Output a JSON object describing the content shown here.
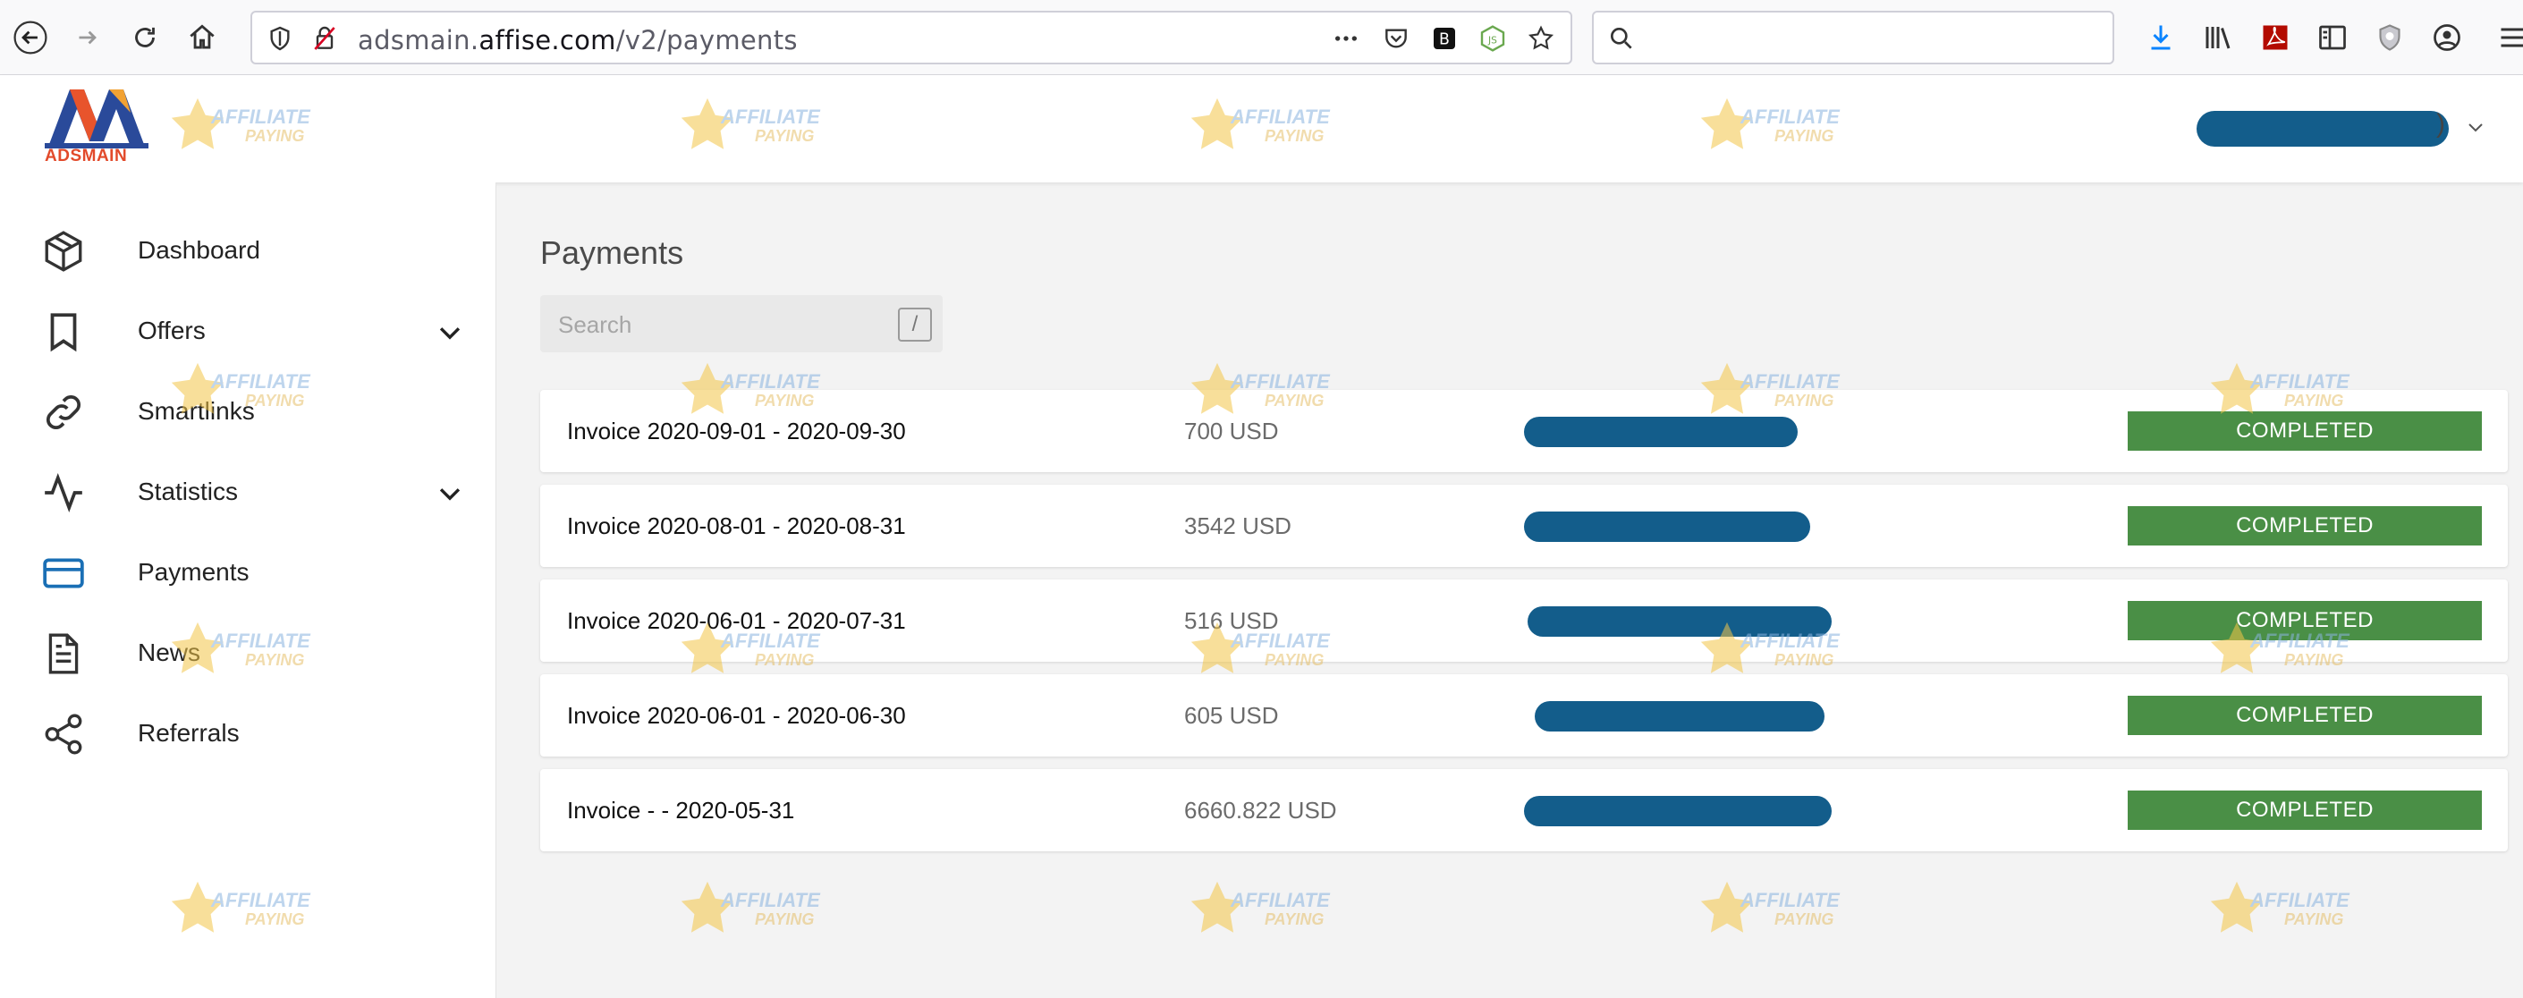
{
  "browser": {
    "url_prefix": "adsmain.",
    "url_domain": "affise.com",
    "url_path": "/v2/payments"
  },
  "logo": {
    "text": "ADSMAIN"
  },
  "header": {
    "user_suffix": ")"
  },
  "sidebar": {
    "items": [
      {
        "label": "Dashboard",
        "icon": "dashboard-cube-icon"
      },
      {
        "label": "Offers",
        "icon": "bookmark-icon",
        "expandable": true
      },
      {
        "label": "Smartlinks",
        "icon": "link-icon"
      },
      {
        "label": "Statistics",
        "icon": "activity-icon",
        "expandable": true
      },
      {
        "label": "Payments",
        "icon": "credit-card-icon",
        "active": true
      },
      {
        "label": "News",
        "icon": "document-icon"
      },
      {
        "label": "Referrals",
        "icon": "share-icon"
      }
    ]
  },
  "main": {
    "title": "Payments",
    "search_placeholder": "Search",
    "search_shortcut": "/",
    "payments": [
      {
        "invoice": "Invoice 2020-09-01 - 2020-09-30",
        "amount": "700 USD",
        "status": "COMPLETED"
      },
      {
        "invoice": "Invoice 2020-08-01 - 2020-08-31",
        "amount": "3542 USD",
        "status": "COMPLETED"
      },
      {
        "invoice": "Invoice 2020-06-01 - 2020-07-31",
        "amount": "516 USD",
        "status": "COMPLETED"
      },
      {
        "invoice": "Invoice 2020-06-01 - 2020-06-30",
        "amount": "605 USD",
        "status": "COMPLETED"
      },
      {
        "invoice": "Invoice - - 2020-05-31",
        "amount": "6660.822 USD",
        "status": "COMPLETED"
      }
    ]
  },
  "colors": {
    "status_completed": "#4a8f46",
    "redaction": "#135d8b",
    "active_accent": "#1a6fb5"
  },
  "watermark": {
    "line1": "AFFILIATE",
    "line2": "PAYING"
  }
}
